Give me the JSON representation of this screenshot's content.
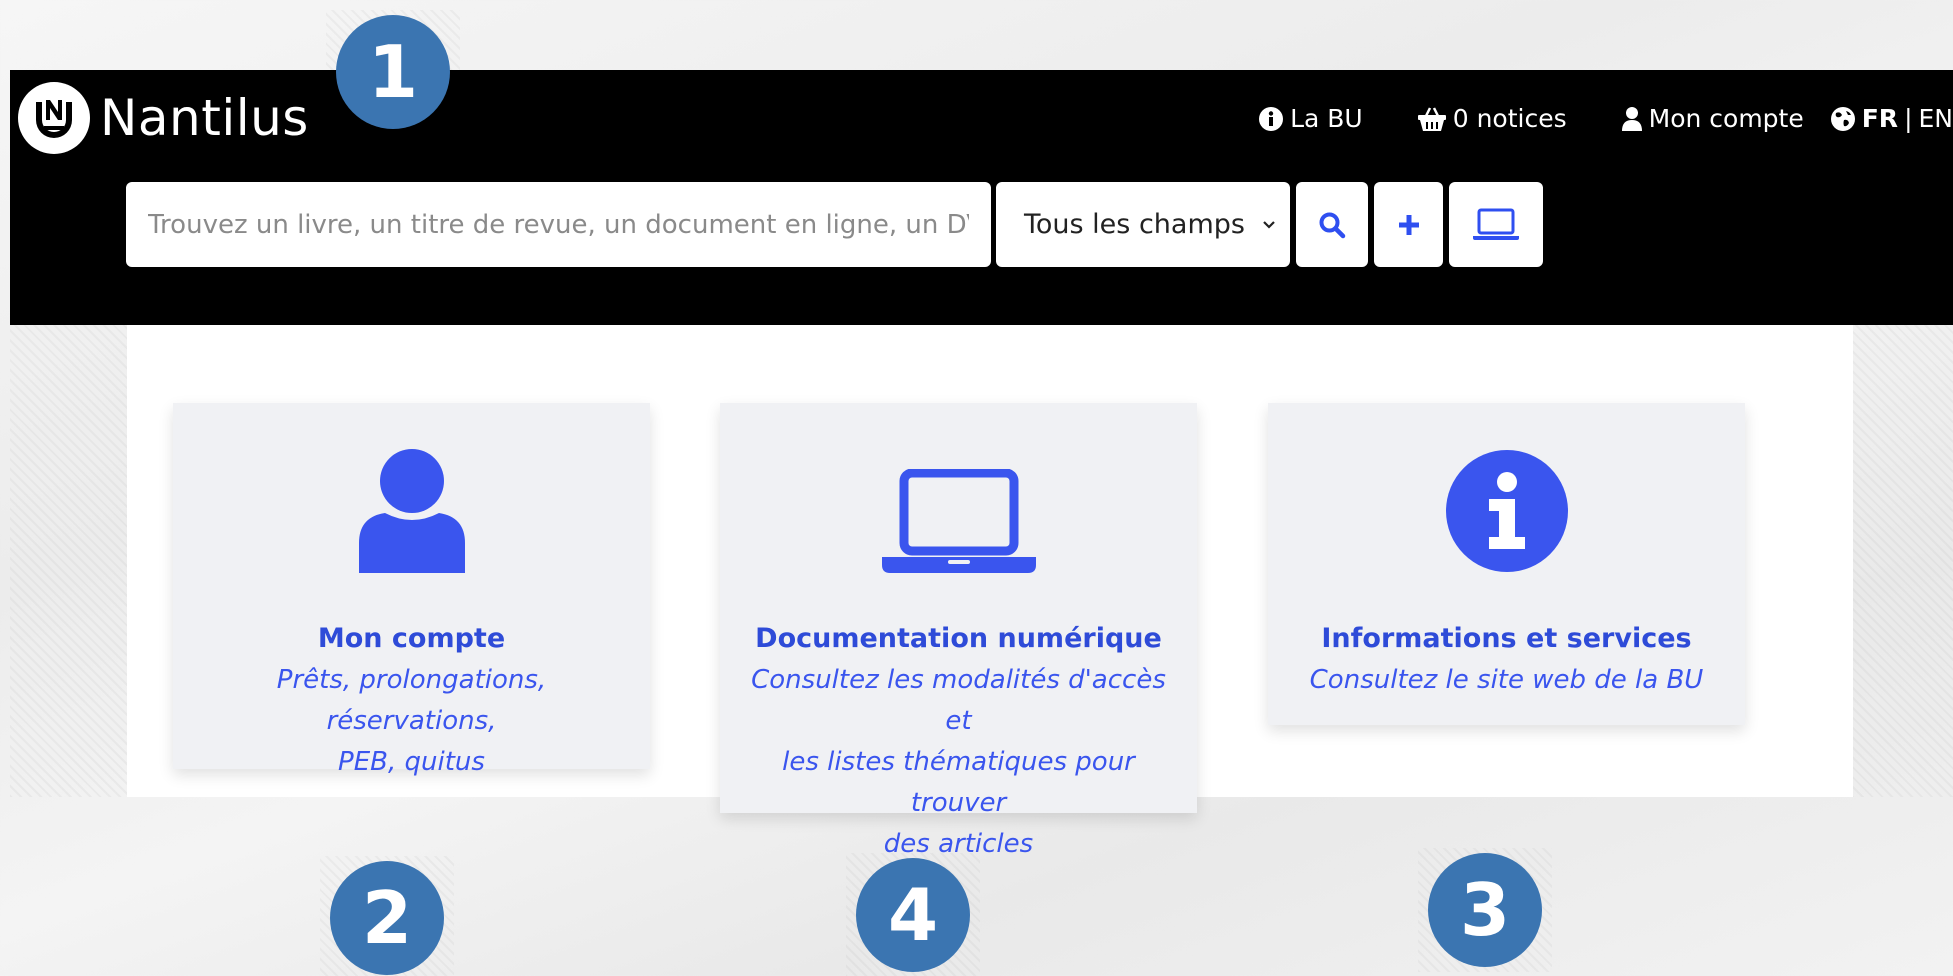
{
  "header": {
    "logo_text": "Nantilus",
    "nav": {
      "la_bu": "La BU",
      "notices": "0 notices",
      "account": "Mon compte",
      "lang_fr": "FR",
      "lang_sep": "|",
      "lang_en": "EN"
    },
    "search": {
      "placeholder": "Trouvez un livre, un titre de revue, un document en ligne, un DVD, …",
      "field_selected": "Tous les champs"
    }
  },
  "cards": [
    {
      "title": "Mon compte",
      "desc_lines": [
        "Prêts, prolongations, réservations,",
        "PEB, quitus"
      ]
    },
    {
      "title": "Documentation numérique",
      "desc_lines": [
        "Consultez les modalités d'accès et",
        "les listes thématiques pour trouver",
        "des articles"
      ]
    },
    {
      "title": "Informations et services",
      "desc_lines": [
        "Consultez le site web de la BU"
      ]
    }
  ],
  "badges": [
    "1",
    "2",
    "4",
    "3"
  ],
  "colors": {
    "accent": "#3a55ee",
    "badge": "#3b75b1",
    "header_bg": "#000000",
    "card_bg": "#f0f1f4"
  },
  "icons": {
    "logo": "nantilus-logo-icon",
    "info": "info-circle-icon",
    "basket": "basket-icon",
    "user": "user-icon",
    "globe": "globe-icon",
    "search": "search-icon",
    "plus": "plus-icon",
    "laptop": "laptop-icon"
  }
}
